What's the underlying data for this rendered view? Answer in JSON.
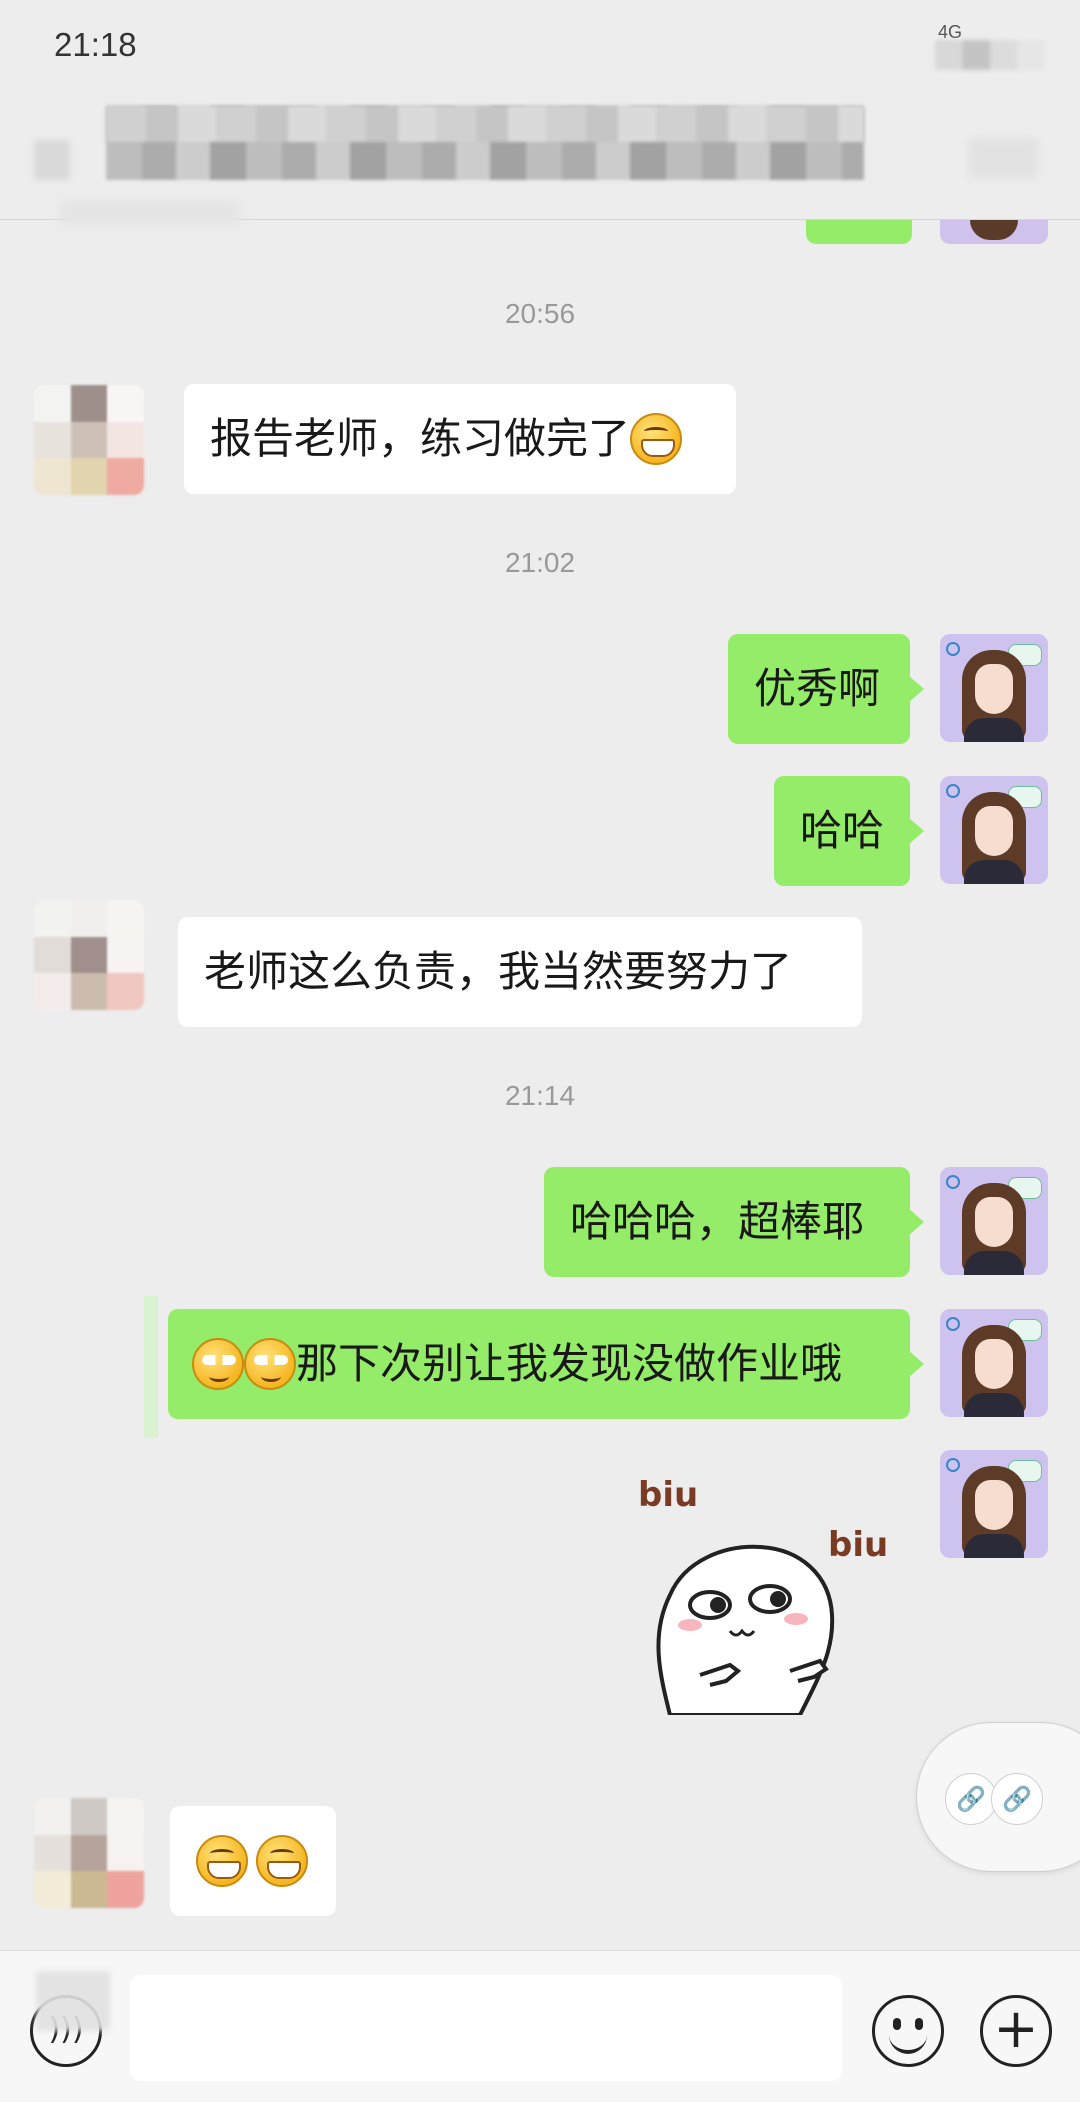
{
  "status_bar": {
    "time": "21:18",
    "network": "4G"
  },
  "header": {
    "title": "",
    "back_icon": "chevron-left-icon",
    "more_icon": "more-icon"
  },
  "messages": [
    {
      "type": "timestamp",
      "text": "20:56"
    },
    {
      "type": "incoming",
      "text": "报告老师，练习做完了",
      "emoji": "grin"
    },
    {
      "type": "timestamp",
      "text": "21:02"
    },
    {
      "type": "outgoing",
      "text": "优秀啊"
    },
    {
      "type": "outgoing",
      "text": "哈哈"
    },
    {
      "type": "incoming",
      "text": "老师这么负责，我当然要努力了"
    },
    {
      "type": "timestamp",
      "text": "21:14"
    },
    {
      "type": "outgoing",
      "text": "哈哈哈，超棒耶"
    },
    {
      "type": "outgoing",
      "text": "那下次别让我发现没做作业哦",
      "emoji": "smug-x2"
    },
    {
      "type": "outgoing-sticker",
      "sticker_text_1": "biu",
      "sticker_text_2": "biu"
    },
    {
      "type": "incoming",
      "emoji": "grin-x2"
    }
  ],
  "input_bar": {
    "voice_icon": "voice-icon",
    "emoji_icon": "emoji-icon",
    "plus_icon": "plus-icon",
    "placeholder": ""
  },
  "floating": {
    "link_icon": "link-icon"
  },
  "colors": {
    "background": "#ededed",
    "outgoing_bubble": "#95ec69",
    "incoming_bubble": "#ffffff",
    "timestamp": "#999999"
  }
}
